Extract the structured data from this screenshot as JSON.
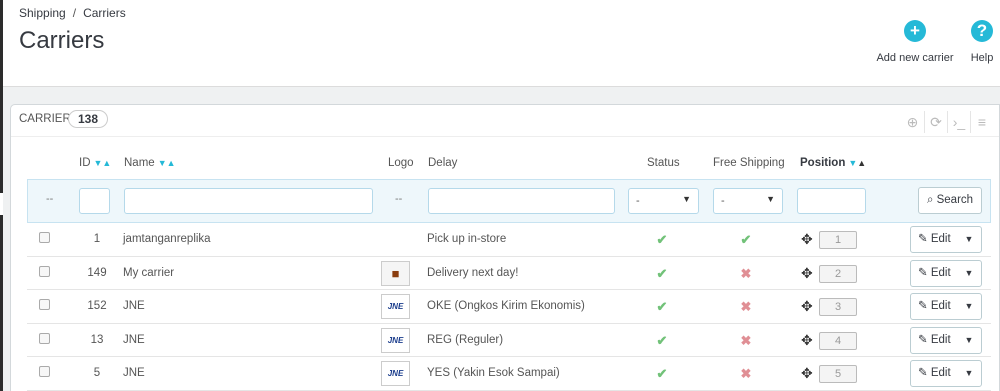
{
  "breadcrumb": {
    "parent": "Shipping",
    "separator": "/",
    "current": "Carriers"
  },
  "page_title": "Carriers",
  "toolbar": {
    "add_label": "Add new carrier",
    "help_label": "Help"
  },
  "panel": {
    "title": "CARRIERS",
    "count": "138"
  },
  "columns": {
    "id": "ID",
    "name": "Name",
    "logo": "Logo",
    "delay": "Delay",
    "status": "Status",
    "free_shipping": "Free Shipping",
    "position": "Position"
  },
  "filters": {
    "bulk_dash": "--",
    "logo_dash": "--",
    "status_value": "-",
    "free_value": "-",
    "search_label": "Search"
  },
  "rows": [
    {
      "id": "1",
      "name": "jamtanganreplika",
      "logo": "",
      "delay": "Pick up in-store",
      "status": "✔",
      "free": "✔",
      "position": "1",
      "edit": "Edit"
    },
    {
      "id": "149",
      "name": "My carrier",
      "logo": "truck",
      "delay": "Delivery next day!",
      "status": "✔",
      "free": "✖",
      "position": "2",
      "edit": "Edit"
    },
    {
      "id": "152",
      "name": "JNE",
      "logo": "JNE",
      "delay": "OKE (Ongkos Kirim Ekonomis)",
      "status": "✔",
      "free": "✖",
      "position": "3",
      "edit": "Edit"
    },
    {
      "id": "13",
      "name": "JNE",
      "logo": "JNE",
      "delay": "REG (Reguler)",
      "status": "✔",
      "free": "✖",
      "position": "4",
      "edit": "Edit"
    },
    {
      "id": "5",
      "name": "JNE",
      "logo": "JNE",
      "delay": "YES (Yakin Esok Sampai)",
      "status": "✔",
      "free": "✖",
      "position": "5",
      "edit": "Edit"
    }
  ],
  "colors": {
    "accent": "#25b9d7",
    "check": "#72c279",
    "cross": "#e08f95"
  }
}
